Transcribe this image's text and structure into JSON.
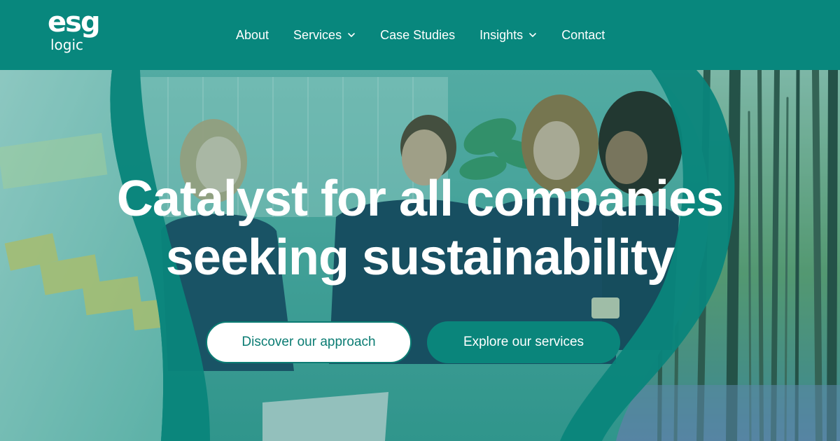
{
  "brand": {
    "logo_primary": "esg",
    "logo_secondary": "logic",
    "accent_color": "#08877d",
    "button_text_color": "#0b7c73"
  },
  "nav": {
    "items": [
      {
        "label": "About",
        "has_dropdown": false
      },
      {
        "label": "Services",
        "has_dropdown": true
      },
      {
        "label": "Case Studies",
        "has_dropdown": false
      },
      {
        "label": "Insights",
        "has_dropdown": true
      },
      {
        "label": "Contact",
        "has_dropdown": false
      }
    ]
  },
  "hero": {
    "headline_line1": "Catalyst for all companies",
    "headline_line2": "seeking sustainability",
    "primary_cta": "Discover our approach",
    "secondary_cta": "Explore our services"
  },
  "icons": {
    "dropdown": "chevron-down-icon"
  }
}
